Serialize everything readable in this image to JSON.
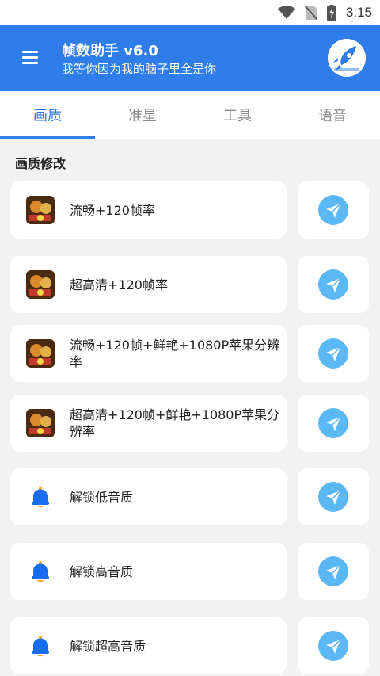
{
  "status_bar": {
    "time": "3:15",
    "icons": [
      "wifi-icon",
      "no-sim-icon",
      "battery-charging-icon"
    ]
  },
  "app_bar": {
    "title": "帧数助手 v6.0",
    "subtitle": "我等你因为我的脑子里全是你",
    "menu_icon": "menu-icon",
    "logo_icon": "rocket-logo-icon"
  },
  "tabs": [
    {
      "label": "画质",
      "active": true
    },
    {
      "label": "准星",
      "active": false
    },
    {
      "label": "工具",
      "active": false
    },
    {
      "label": "语音",
      "active": false
    }
  ],
  "section": {
    "title": "画质修改"
  },
  "items": [
    {
      "label": "流畅+120帧率",
      "icon": "game-avatar-icon"
    },
    {
      "label": "超高清+120帧率",
      "icon": "game-avatar-icon"
    },
    {
      "label": "流畅+120帧+鲜艳+1080P苹果分辨率",
      "icon": "game-avatar-icon"
    },
    {
      "label": "超高清+120帧+鲜艳+1080P苹果分辨率",
      "icon": "game-avatar-icon"
    },
    {
      "label": "解锁低音质",
      "icon": "bell-icon"
    },
    {
      "label": "解锁高音质",
      "icon": "bell-icon"
    },
    {
      "label": "解锁超高音质",
      "icon": "bell-icon"
    }
  ],
  "action_icon": "send-icon",
  "colors": {
    "primary": "#2e7de9",
    "action": "#5bb8f4",
    "background": "#f2f2f2"
  }
}
